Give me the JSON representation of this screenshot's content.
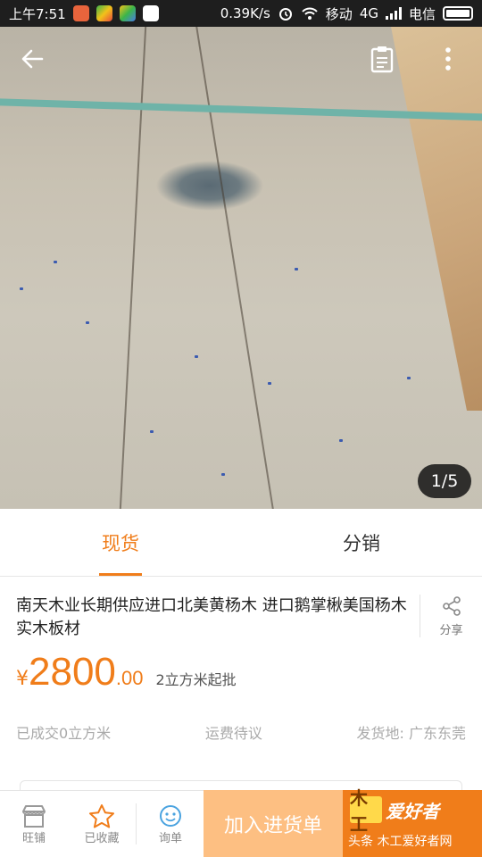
{
  "status_bar": {
    "time": "上午7:51",
    "speed": "0.39K/s",
    "carrier1": "移动",
    "network": "4G",
    "carrier2": "电信"
  },
  "gallery": {
    "counter": "1/5"
  },
  "tabs": [
    {
      "label": "现货",
      "active": true
    },
    {
      "label": "分销",
      "active": false
    }
  ],
  "product": {
    "title": "南天木业长期供应进口北美黄杨木 进口鹅掌楸美国杨木实木板材",
    "share_label": "分享",
    "price_symbol": "¥",
    "price_int": "2800",
    "price_dec": ".00",
    "min_order": "2立方米起批",
    "sold": "已成交0立方米",
    "shipping": "运费待议",
    "origin": "发货地: 广东东莞"
  },
  "bottom_bar": {
    "shop_label": "旺铺",
    "favorite_label": "已收藏",
    "inquiry_label": "询单",
    "add_label": "加入进货单"
  },
  "watermark": {
    "mark": "木工",
    "brand": "爱好者",
    "text": "头条 木工爱好者网"
  },
  "colors": {
    "accent": "#f07d1a",
    "accent_light": "#fdbf82"
  }
}
